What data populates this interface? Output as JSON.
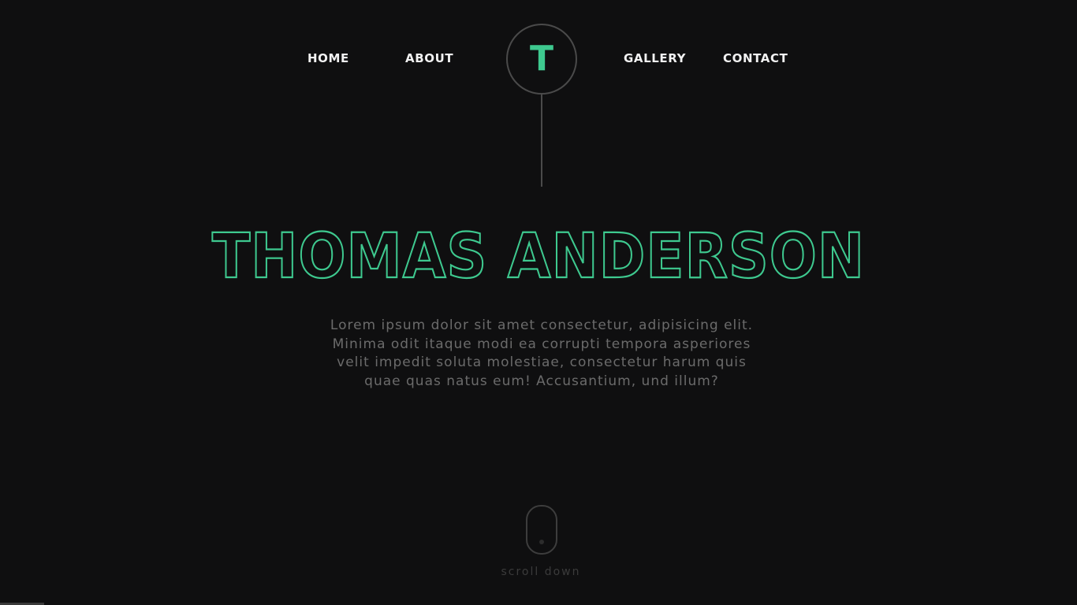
{
  "nav": {
    "home": "HOME",
    "about": "ABOUT",
    "gallery": "GALLERY",
    "contact": "CONTACT",
    "logo_letter": "T"
  },
  "hero": {
    "name": "THOMAS ANDERSON",
    "description": "Lorem ipsum dolor sit amet consectetur, adipisicing elit. Minima odit itaque modi ea corrupti tempora asperiores velit impedit soluta molestiae, consectetur harum quis quae quas natus eum! Accusantium, und illum?"
  },
  "scroll": {
    "label": "scroll down",
    "icon": "mouse-scroll-icon"
  },
  "colors": {
    "background": "#0f0f10",
    "accent": "#3ec98f",
    "nav_text": "#f2f2f2",
    "muted_text": "#6b6b6b",
    "outline": "#4a4a4a"
  }
}
